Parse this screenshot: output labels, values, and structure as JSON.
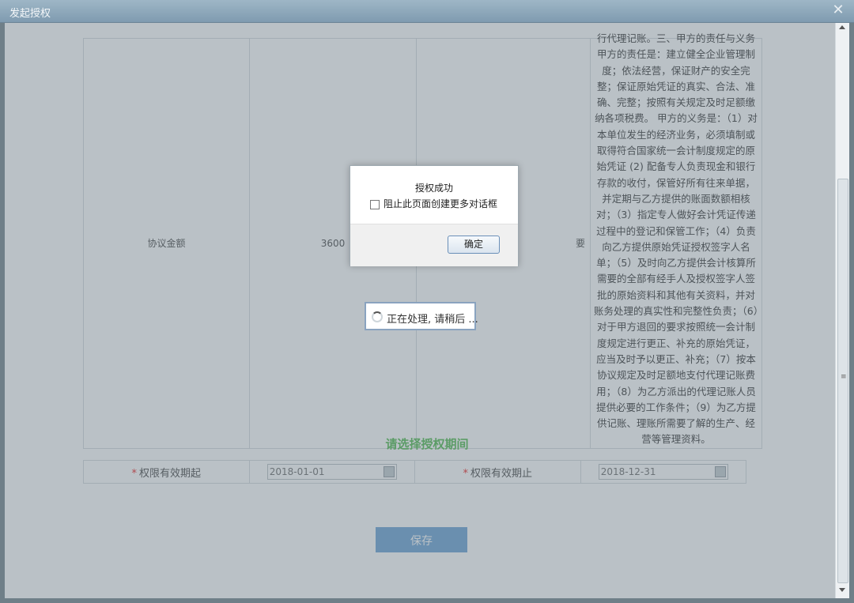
{
  "window": {
    "title": "发起授权",
    "close_symbol": "✕"
  },
  "agreement": {
    "label": "协议金额",
    "amount": "3600",
    "note": "要",
    "text": "行代理记账。三、甲方的责任与义务 甲方的责任是：建立健全企业管理制度；依法经营，保证财产的安全完整；保证原始凭证的真实、合法、准确、完整；按照有关规定及时足额缴纳各项税费。 甲方的义务是：（1）对本单位发生的经济业务，必须填制或取得符合国家统一会计制度规定的原始凭证 (2) 配备专人负责现金和银行存款的收付，保管好所有往来单据，并定期与乙方提供的账面数额相核对；（3）指定专人做好会计凭证传递过程中的登记和保管工作；（4）负责向乙方提供原始凭证授权签字人名单；（5）及时向乙方提供会计核算所需要的全部有经手人及授权签字人签批的原始资料和其他有关资料，并对账务处理的真实性和完整性负责；（6）对于甲方退回的要求按照统一会计制度规定进行更正、补充的原始凭证，应当及时予以更正、补充；（7）按本协议规定及时足额地支付代理记账费用；（8）为乙方派出的代理记账人员提供必要的工作条件；（9）为乙方提供记账、理账所需要了解的生产、经营等管理资料。"
  },
  "period": {
    "section_title": "请选择授权期间",
    "required_mark": "*",
    "start_label": "权限有效期起",
    "start_value": "2018-01-01",
    "end_label": "权限有效期止",
    "end_value": "2018-12-31"
  },
  "save_label": "保存",
  "loading": {
    "message": "正在处理, 请稍后 ..."
  },
  "dialog": {
    "title": "授权成功",
    "checkbox_label": "阻止此页面创建更多对话框",
    "ok_label": "确定"
  },
  "colors": {
    "title_accent": "#5cbf5a",
    "save_button": "#76a9d8",
    "required": "#e33333"
  }
}
